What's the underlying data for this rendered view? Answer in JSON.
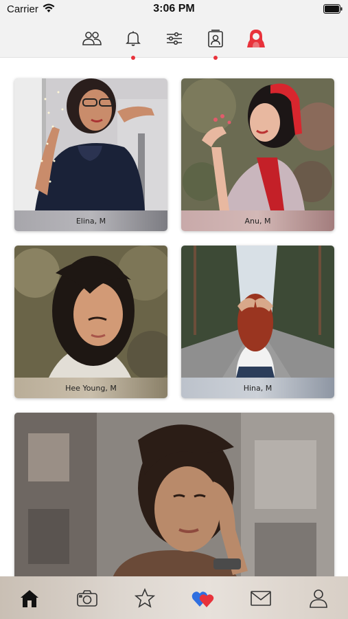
{
  "status_bar": {
    "carrier": "Carrier",
    "time": "3:06 PM"
  },
  "top_nav": {
    "items": [
      {
        "icon": "people-icon"
      },
      {
        "icon": "bell-icon",
        "notification": true
      },
      {
        "icon": "sliders-icon"
      },
      {
        "icon": "contact-card-icon",
        "notification": true
      },
      {
        "icon": "user-hood-icon",
        "active": true
      }
    ],
    "accent": "#e8323b"
  },
  "profiles": [
    {
      "name": "Elina, M"
    },
    {
      "name": "Anu, M"
    },
    {
      "name": "Hee Young, M"
    },
    {
      "name": "Hina, M"
    },
    {
      "name": ""
    }
  ],
  "tab_bar": {
    "items": [
      {
        "icon": "home-icon",
        "active": true
      },
      {
        "icon": "camera-icon"
      },
      {
        "icon": "star-icon"
      },
      {
        "icon": "hearts-icon",
        "colors": [
          "#2f6fe0",
          "#e8323b"
        ]
      },
      {
        "icon": "mail-icon"
      },
      {
        "icon": "profile-icon"
      }
    ]
  }
}
